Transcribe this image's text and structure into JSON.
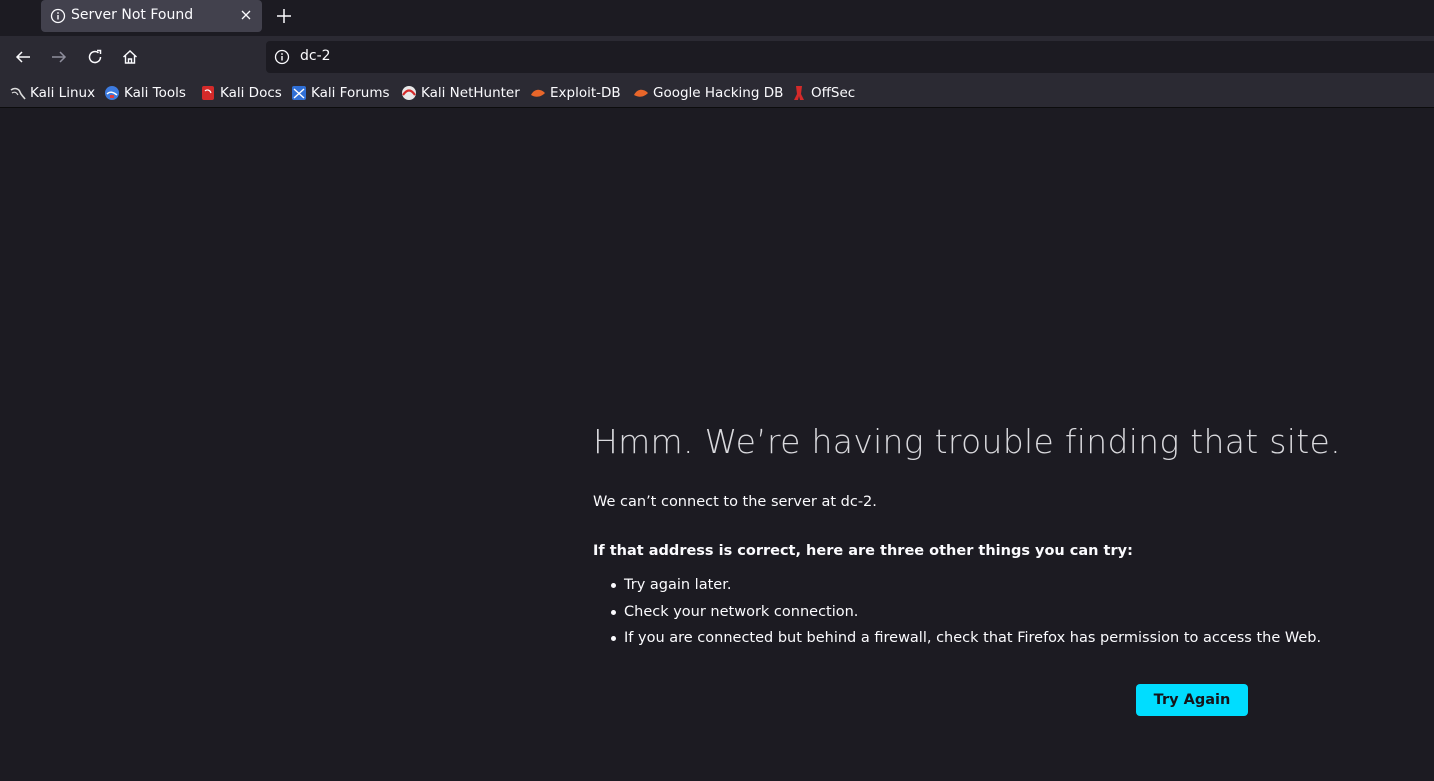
{
  "tab": {
    "title": "Server Not Found"
  },
  "urlbar": {
    "url": "dc-2"
  },
  "bookmarks": [
    {
      "label": "Kali Linux",
      "icon": "kali-dragon-icon"
    },
    {
      "label": "Kali Tools",
      "icon": "kali-tools-icon"
    },
    {
      "label": "Kali Docs",
      "icon": "kali-docs-icon"
    },
    {
      "label": "Kali Forums",
      "icon": "kali-forums-icon"
    },
    {
      "label": "Kali NetHunter",
      "icon": "kali-nethunter-icon"
    },
    {
      "label": "Exploit-DB",
      "icon": "exploit-db-icon"
    },
    {
      "label": "Google Hacking DB",
      "icon": "google-hacking-db-icon"
    },
    {
      "label": "OffSec",
      "icon": "offsec-icon"
    }
  ],
  "error": {
    "title": "Hmm. We’re having trouble finding that site.",
    "description": "We can’t connect to the server at dc-2.",
    "subtitle": "If that address is correct, here are three other things you can try:",
    "suggestions": [
      "Try again later.",
      "Check your network connection.",
      "If you are connected but behind a firewall, check that Firefox has permission to access the Web."
    ],
    "button_label": "Try Again"
  },
  "colors": {
    "accent": "#00ddff",
    "page_background": "#1c1b22",
    "toolbar_background": "#2b2a33"
  }
}
